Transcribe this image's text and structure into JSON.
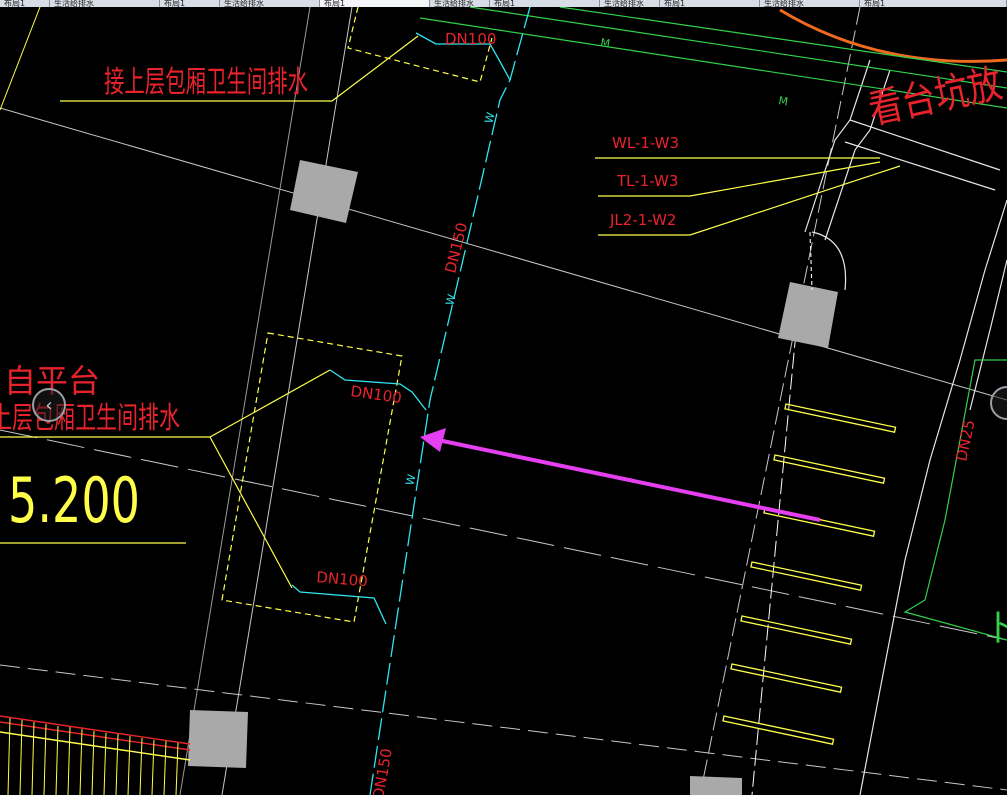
{
  "tabs": [
    "布局1",
    "生活给排水",
    "布局1",
    "生活给排水",
    "布局1",
    "生活给排水",
    "布局1",
    "生活给排水",
    "布局1",
    "生活给排水",
    "布局1"
  ],
  "annotations": {
    "top_left_note": "接上层包厢卫生间排水",
    "mid_left_note": "接上层包厢卫生间排水",
    "platform_text": "自平台",
    "elevation": "5.200",
    "top_right_text": "看台坑放",
    "right_edge_glyph": "卜"
  },
  "pipe_labels": {
    "dn100_top": "DN100",
    "dn100_mid": "DN100",
    "dn100_low": "DN100",
    "dn150_vertical": "DN150",
    "dn150_bottom": "DN150",
    "dn25_right": "DN25",
    "riser_wl": "WL-1-W3",
    "riser_tl": "TL-1-W3",
    "riser_jl": "JL2-1-W2",
    "pipe_letter_w": "W",
    "pipe_letter_m": "M"
  },
  "colors": {
    "background": "#000000",
    "red_text": "#e8232b",
    "cyan_pipe": "#2ee6f0",
    "yellow": "#ffff4a",
    "magenta_arrow": "#e43ff0",
    "green": "#33d04a",
    "orange_arc": "#ee6a1f",
    "column_gray": "#a9a9a9",
    "grid_gray": "#c7c7c7"
  },
  "nav": {
    "left_icon": "chevron-left-icon",
    "right_icon": "circle-button-icon"
  }
}
